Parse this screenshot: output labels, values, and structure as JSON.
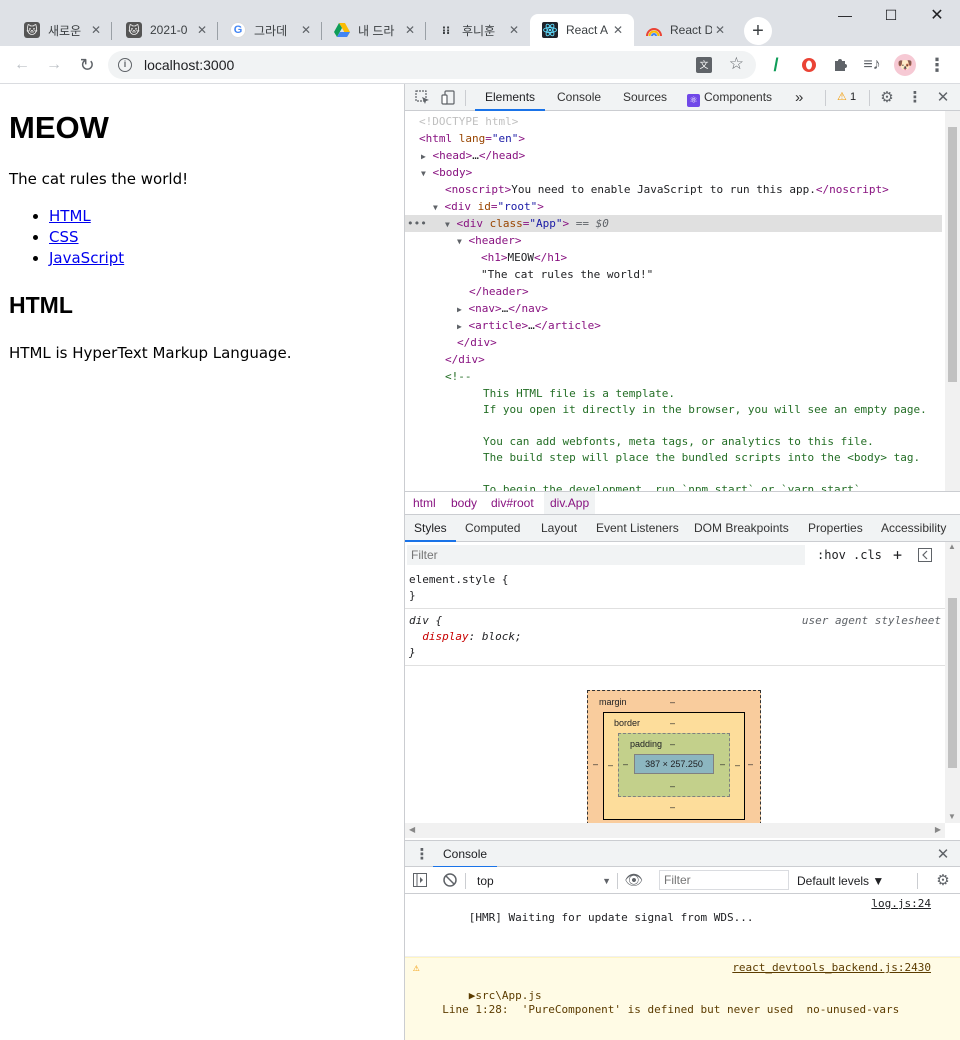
{
  "browser": {
    "tabs": [
      {
        "title": "새로운",
        "favicon": "cat-avatar-icon",
        "active": false
      },
      {
        "title": "2021-0",
        "favicon": "cat-avatar-icon",
        "active": false
      },
      {
        "title": "그라데",
        "favicon": "google-icon",
        "active": false
      },
      {
        "title": "내 드라",
        "favicon": "drive-icon",
        "active": false
      },
      {
        "title": "후니훈",
        "favicon": "dots-icon",
        "active": false
      },
      {
        "title": "React A",
        "favicon": "react-icon",
        "active": true
      },
      {
        "title": "React D",
        "favicon": "rainbow-icon",
        "active": false
      }
    ],
    "url": "localhost:3000"
  },
  "page": {
    "h1": "MEOW",
    "tagline": "The cat rules the world!",
    "nav_links": [
      "HTML",
      "CSS",
      "JavaScript"
    ],
    "article_title": "HTML",
    "article_body": "HTML is HyperText Markup Language."
  },
  "devtools": {
    "tabs": [
      "Elements",
      "Console",
      "Sources",
      "Components"
    ],
    "more": "»",
    "warning_count": "1",
    "dom": {
      "doctype": "<!DOCTYPE html>",
      "html_open": "html",
      "html_attr": "lang",
      "html_val": "\"en\"",
      "head": "head",
      "body": "body",
      "noscript_text": "You need to enable JavaScript to run this app.",
      "root_attr": "id",
      "root_val": "\"root\"",
      "app_attr": "class",
      "app_val": "\"App\"",
      "selected_marker": " == $0",
      "header": "header",
      "h1_text": "MEOW",
      "header_text": "\"The cat rules the world!\"",
      "nav": "nav",
      "article": "article",
      "comment_open": "<!--",
      "comment_lines": [
        "This HTML file is a template.",
        "If you open it directly in the browser, you will see an empty page.",
        "",
        "You can add webfonts, meta tags, or analytics to this file.",
        "The build step will place the bundled scripts into the <body> tag.",
        "",
        "To begin the development, run `npm start` or `yarn start`."
      ]
    },
    "breadcrumbs": [
      "html",
      "body",
      "div#root",
      "div.App"
    ],
    "styles_tabs": [
      "Styles",
      "Computed",
      "Layout",
      "Event Listeners",
      "DOM Breakpoints",
      "Properties",
      "Accessibility"
    ],
    "filter_placeholder": "Filter",
    "hov": ":hov",
    "cls": ".cls",
    "rules": {
      "element_style": "element.style {",
      "close": "}",
      "div_selector": "div {",
      "div_source": "user agent stylesheet",
      "div_prop": "display",
      "div_val": "block;"
    },
    "box_model": {
      "margin_label": "margin",
      "border_label": "border",
      "padding_label": "padding",
      "content_size": "387 × 257.250",
      "dash": "–"
    }
  },
  "console": {
    "drawer_tab": "Console",
    "context": "top",
    "filter_placeholder": "Filter",
    "levels": "Default levels ▼",
    "messages": [
      {
        "type": "log",
        "text": "[HMR] Waiting for update signal from WDS...",
        "source": "log.js:24"
      },
      {
        "type": "warning",
        "text": "▶src\\App.js\n  Line 1:28:  'PureComponent' is defined but never used  no-unused-vars",
        "source": "react_devtools_backend.js:2430"
      }
    ],
    "prompt": "›"
  },
  "colors": {
    "link": "#0000ee",
    "accent": "#1a73e8",
    "tag": "#881280",
    "attr_name": "#994500",
    "attr_value": "#1a1aa6",
    "comment": "#236e25",
    "warning": "#f29900"
  }
}
